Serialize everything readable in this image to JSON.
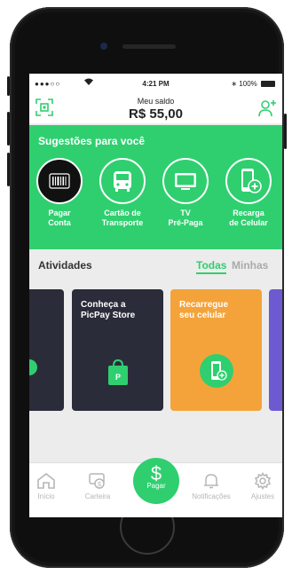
{
  "status_bar": {
    "signal": "●●●○○",
    "time": "4:21 PM",
    "battery": "100%"
  },
  "header": {
    "balance_label": "Meu saldo",
    "balance_value": "R$ 55,00"
  },
  "suggestions": {
    "title": "Sugestões para você",
    "items": [
      {
        "line1": "Pagar",
        "line2": "Conta",
        "icon": "barcode-icon"
      },
      {
        "line1": "Cartão de",
        "line2": "Transporte",
        "icon": "bus-icon"
      },
      {
        "line1": "TV",
        "line2": "Pré-Paga",
        "icon": "tv-icon"
      },
      {
        "line1": "Recarga",
        "line2": "de Celular",
        "icon": "phone-recharge-icon"
      }
    ]
  },
  "activities": {
    "title": "Atividades",
    "tab_all": "Todas",
    "tab_mine": "Minhas",
    "cards": [
      {
        "line1": "Conheça a",
        "line2": "PicPay Store",
        "icon": "shopping-bag-icon",
        "color": "#2a2c3a"
      },
      {
        "line1": "Recarregue",
        "line2": "seu celular",
        "icon": "phone-recharge-icon",
        "color": "#f4a33a"
      }
    ]
  },
  "tabbar": {
    "home": "Início",
    "wallet": "Carteira",
    "pay": "Pagar",
    "notifications": "Notificações",
    "settings": "Ajustes"
  },
  "colors": {
    "brand_green": "#2fcf6f",
    "dark_card": "#2a2c3a",
    "orange_card": "#f4a33a",
    "purple_card": "#6d5ad0"
  }
}
